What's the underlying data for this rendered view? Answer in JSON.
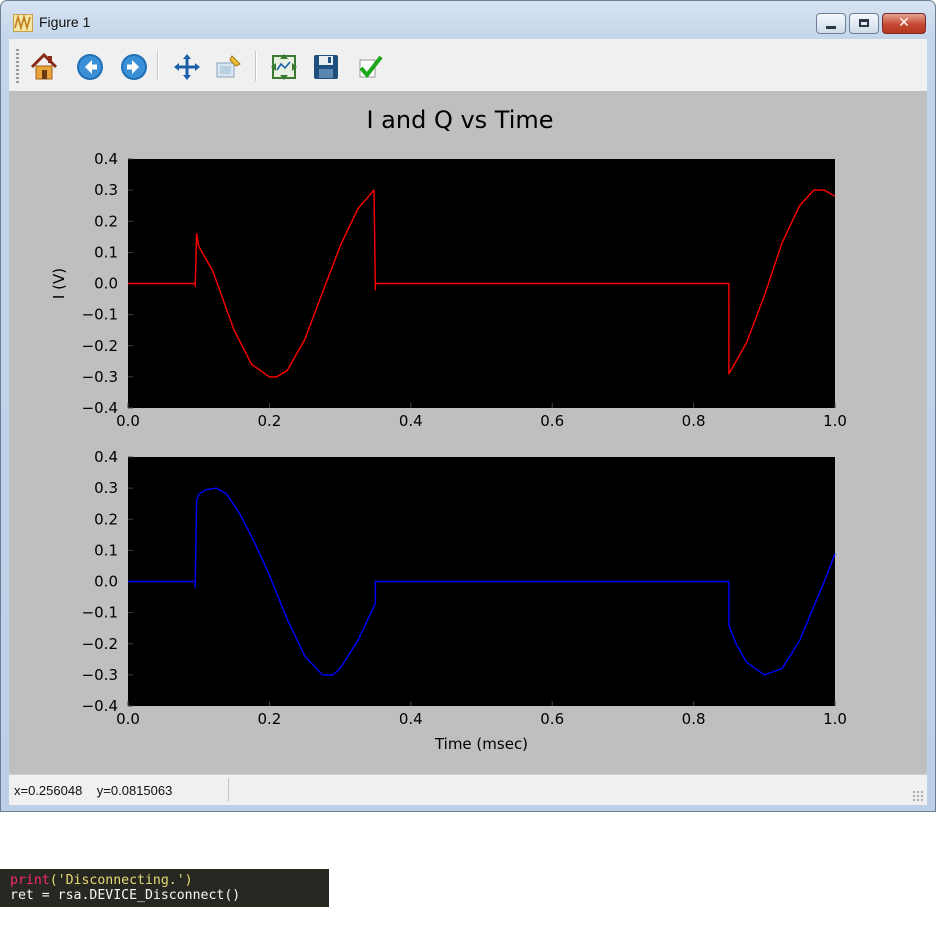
{
  "window": {
    "title": "Figure 1",
    "buttons": {
      "minimize": "minimize",
      "maximize": "maximize",
      "close": "close"
    }
  },
  "toolbar": {
    "tools": [
      {
        "name": "home-icon",
        "tooltip": "Reset original view"
      },
      {
        "name": "back-icon",
        "tooltip": "Back to previous view"
      },
      {
        "name": "forward-icon",
        "tooltip": "Forward to next view"
      },
      {
        "name": "pan-icon",
        "tooltip": "Pan axes"
      },
      {
        "name": "zoom-rect-icon",
        "tooltip": "Zoom to rectangle"
      },
      {
        "name": "subplots-icon",
        "tooltip": "Configure subplots"
      },
      {
        "name": "save-icon",
        "tooltip": "Save the figure"
      },
      {
        "name": "edit-params-icon",
        "tooltip": "Edit curve parameters"
      }
    ]
  },
  "figure": {
    "title": "I and Q vs Time",
    "background": "#bfbfbf",
    "axes_background": "#000000"
  },
  "status": {
    "x_label": "x=0.256048",
    "y_label": "y=0.0815063"
  },
  "code": {
    "line1_func": "print",
    "line1_arg": "('Disconnecting.')",
    "line2": "ret = rsa.DEVICE_Disconnect()"
  },
  "chart_data": [
    {
      "type": "line",
      "title": "I and Q vs Time",
      "xlabel": "",
      "ylabel": "I (V)",
      "xlim": [
        0.0,
        1.0
      ],
      "ylim": [
        -0.4,
        0.4
      ],
      "xticks": [
        "0.0",
        "0.2",
        "0.4",
        "0.6",
        "0.8",
        "1.0"
      ],
      "yticks": [
        "0.4",
        "0.3",
        "0.2",
        "0.1",
        "0.0",
        "−0.1",
        "−0.2",
        "−0.3",
        "−0.4"
      ],
      "grid": false,
      "series": [
        {
          "color": "#ff0000",
          "x": [
            0.0,
            0.095,
            0.095,
            0.097,
            0.1,
            0.12,
            0.15,
            0.175,
            0.2,
            0.21,
            0.225,
            0.25,
            0.275,
            0.3,
            0.325,
            0.348,
            0.35,
            0.35,
            0.4,
            0.5,
            0.6,
            0.7,
            0.8,
            0.85,
            0.85,
            0.86,
            0.875,
            0.9,
            0.925,
            0.95,
            0.97,
            0.985,
            1.0
          ],
          "y": [
            0.0,
            0.0,
            -0.01,
            0.16,
            0.12,
            0.04,
            -0.15,
            -0.26,
            -0.3,
            -0.3,
            -0.28,
            -0.18,
            -0.03,
            0.12,
            0.24,
            0.3,
            -0.02,
            0.0,
            0.0,
            0.0,
            0.0,
            0.0,
            0.0,
            0.0,
            -0.29,
            -0.25,
            -0.19,
            -0.04,
            0.13,
            0.25,
            0.3,
            0.3,
            0.28
          ]
        }
      ]
    },
    {
      "type": "line",
      "xlabel": "Time (msec)",
      "ylabel": "",
      "xlim": [
        0.0,
        1.0
      ],
      "ylim": [
        -0.4,
        0.4
      ],
      "xticks": [
        "0.0",
        "0.2",
        "0.4",
        "0.6",
        "0.8",
        "1.0"
      ],
      "yticks": [
        "0.4",
        "0.3",
        "0.2",
        "0.1",
        "0.0",
        "−0.1",
        "−0.2",
        "−0.3",
        "−0.4"
      ],
      "grid": false,
      "series": [
        {
          "color": "#0000ff",
          "x": [
            0.0,
            0.095,
            0.095,
            0.097,
            0.1,
            0.11,
            0.125,
            0.14,
            0.16,
            0.18,
            0.2,
            0.225,
            0.25,
            0.275,
            0.29,
            0.3,
            0.325,
            0.348,
            0.35,
            0.35,
            0.4,
            0.5,
            0.6,
            0.7,
            0.8,
            0.85,
            0.85,
            0.86,
            0.875,
            0.9,
            0.925,
            0.95,
            0.97,
            0.985,
            1.0
          ],
          "y": [
            0.0,
            0.0,
            -0.02,
            0.26,
            0.28,
            0.295,
            0.3,
            0.28,
            0.21,
            0.12,
            0.02,
            -0.12,
            -0.24,
            -0.3,
            -0.3,
            -0.28,
            -0.19,
            -0.08,
            -0.07,
            0.0,
            0.0,
            0.0,
            0.0,
            0.0,
            0.0,
            0.0,
            -0.14,
            -0.2,
            -0.26,
            -0.3,
            -0.28,
            -0.19,
            -0.08,
            0.0,
            0.09
          ]
        }
      ]
    }
  ]
}
